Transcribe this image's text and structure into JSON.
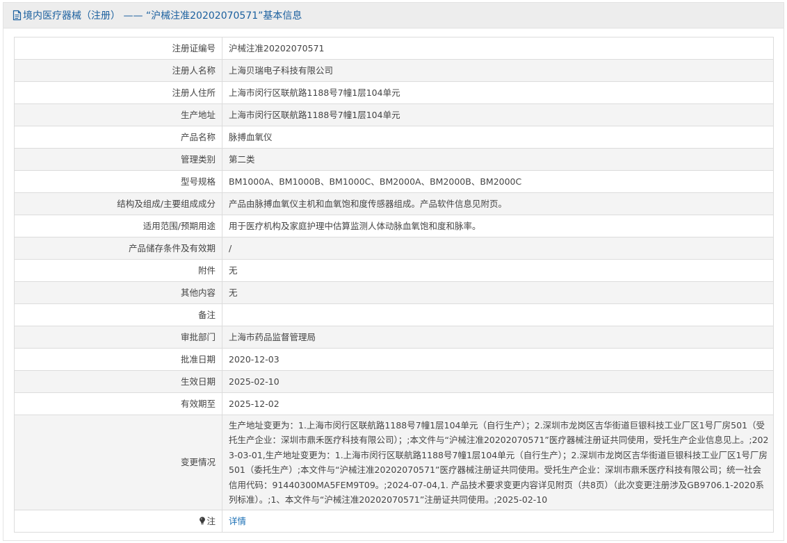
{
  "header": {
    "title": "境内医疗器械（注册） ——  “沪械注准20202070571”基本信息"
  },
  "rows": [
    {
      "label": "注册证编号",
      "value": "沪械注准20202070571"
    },
    {
      "label": "注册人名称",
      "value": "上海贝瑞电子科技有限公司"
    },
    {
      "label": "注册人住所",
      "value": "上海市闵行区联航路1188号7幢1层104单元"
    },
    {
      "label": "生产地址",
      "value": "上海市闵行区联航路1188号7幢1层104单元"
    },
    {
      "label": "产品名称",
      "value": "脉搏血氧仪"
    },
    {
      "label": "管理类别",
      "value": "第二类"
    },
    {
      "label": "型号规格",
      "value": "BM1000A、BM1000B、BM1000C、BM2000A、BM2000B、BM2000C"
    },
    {
      "label": "结构及组成/主要组成成分",
      "value": "产品由脉搏血氧仪主机和血氧饱和度传感器组成。产品软件信息见附页。"
    },
    {
      "label": "适用范围/预期用途",
      "value": "用于医疗机构及家庭护理中估算监测人体动脉血氧饱和度和脉率。"
    },
    {
      "label": "产品储存条件及有效期",
      "value": "/"
    },
    {
      "label": "附件",
      "value": "无"
    },
    {
      "label": "其他内容",
      "value": "无"
    },
    {
      "label": "备注",
      "value": ""
    },
    {
      "label": "审批部门",
      "value": "上海市药品监督管理局"
    },
    {
      "label": "批准日期",
      "value": "2020-12-03"
    },
    {
      "label": "生效日期",
      "value": "2025-02-10"
    },
    {
      "label": "有效期至",
      "value": "2025-12-02"
    }
  ],
  "change": {
    "label": "变更情况",
    "value": "生产地址变更为：1.上海市闵行区联航路1188号7幢1层104单元（自行生产）；2.深圳市龙岗区吉华街道巨银科技工业厂区1号厂房501（受托生产企业：深圳市鼎禾医疗科技有限公司）；;本文件与“沪械注准20202070571”医疗器械注册证共同使用，受托生产企业信息见上。;2023-03-01,生产地址变更为：1.上海市闵行区联航路1188号7幢1层104单元（自行生产）；2.深圳市龙岗区吉华街道巨银科技工业厂区1号厂房501（委托生产）;本文件与“沪械注准20202070571”医疗器械注册证共同使用。受托生产企业：深圳市鼎禾医疗科技有限公司；统一社会信用代码：91440300MA5FEM9T09。;2024-07-04,1. 产品技术要求变更内容详见附页（共8页）（此次变更注册涉及GB9706.1-2020系列标准）。;1、本文件与“沪械注准20202070571”注册证共同使用。;2025-02-10"
  },
  "note": {
    "label": "注",
    "link_text": "详情"
  },
  "icons": {
    "title_icon": "document-icon",
    "note_icon": "lightbulb-icon"
  },
  "colors": {
    "title_text": "#1a5f9e",
    "link": "#1a6fb5",
    "stripe": "#f4f4f4",
    "border": "#dcdcdc"
  }
}
